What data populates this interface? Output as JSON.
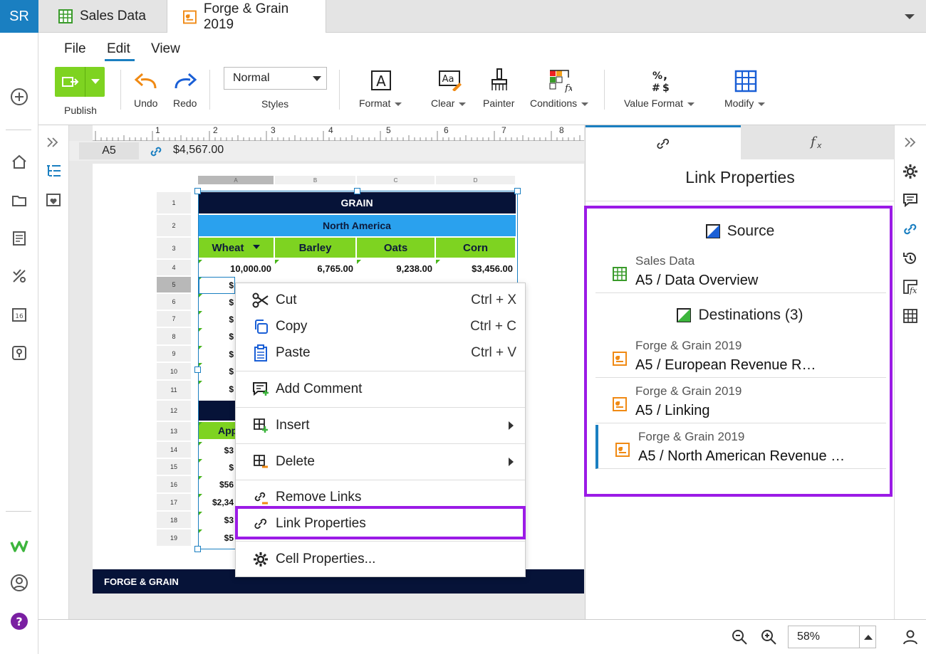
{
  "user": {
    "initials": "SR"
  },
  "tabs": [
    {
      "label": "Sales Data"
    },
    {
      "label": "Forge & Grain 2019"
    }
  ],
  "menu": [
    "File",
    "Edit",
    "View"
  ],
  "ribbon": {
    "publish": "Publish",
    "undo": "Undo",
    "redo": "Redo",
    "styles_value": "Normal",
    "styles_label": "Styles",
    "format": "Format",
    "clear": "Clear",
    "painter": "Painter",
    "conditions": "Conditions",
    "value_format": "Value Format",
    "modify": "Modify"
  },
  "ruler": [
    "1",
    "2",
    "3",
    "4",
    "5",
    "6",
    "7",
    "8"
  ],
  "formula": {
    "cell_ref": "A5",
    "value": "$4,567.00"
  },
  "sheet": {
    "columns": [
      "A",
      "B",
      "C",
      "D"
    ],
    "rows": [
      "1",
      "2",
      "3",
      "4",
      "5",
      "6",
      "7",
      "8",
      "9",
      "10",
      "11",
      "12",
      "13",
      "14",
      "15",
      "16",
      "17",
      "18",
      "19"
    ],
    "title": "GRAIN",
    "region": "North America",
    "headers": [
      "Wheat",
      "Barley",
      "Oats",
      "Corn"
    ],
    "row4": [
      "10,000.00",
      "6,765.00",
      "9,238.00",
      "$3,456.00"
    ],
    "a_cells": [
      "$",
      "$",
      "$",
      "$",
      "$",
      "$",
      "$",
      "",
      "App",
      "$3",
      "$",
      "$56",
      "$2,34",
      "$3",
      "$5"
    ],
    "footer": "FORGE & GRAIN"
  },
  "context_menu": {
    "cut": "Cut",
    "cut_key": "Ctrl + X",
    "copy": "Copy",
    "copy_key": "Ctrl + C",
    "paste": "Paste",
    "paste_key": "Ctrl + V",
    "add_comment": "Add Comment",
    "insert": "Insert",
    "delete": "Delete",
    "remove_links": "Remove Links",
    "link_properties": "Link Properties",
    "cell_properties": "Cell Properties..."
  },
  "link_panel": {
    "title": "Link Properties",
    "source_heading": "Source",
    "source": {
      "doc": "Sales Data",
      "target": "A5 / Data Overview"
    },
    "destinations_heading": "Destinations (3)",
    "destinations": [
      {
        "doc": "Forge & Grain 2019",
        "target": "A5 / European Revenue R…"
      },
      {
        "doc": "Forge & Grain 2019",
        "target": "A5 / Linking"
      },
      {
        "doc": "Forge & Grain 2019",
        "target": "A5 / North American Revenue …"
      }
    ]
  },
  "status": {
    "zoom": "58%"
  },
  "colors": {
    "accent": "#1a7fc1",
    "highlight": "#9b1be6",
    "green": "#7ed321",
    "navy": "#061338",
    "blue_band": "#2aa1ee"
  }
}
